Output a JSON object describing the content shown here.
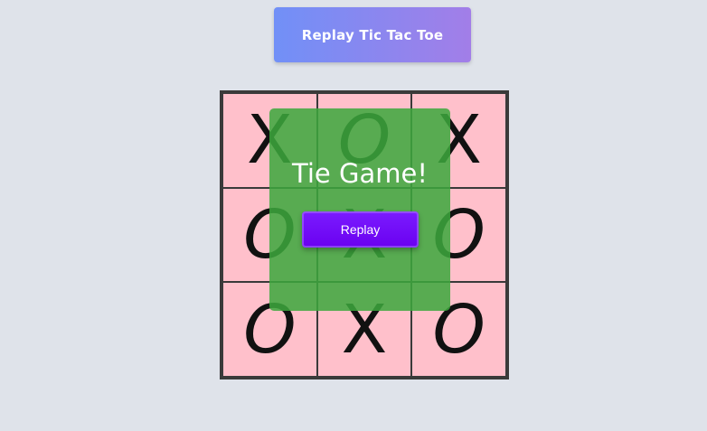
{
  "header": {
    "replay_label": "Replay Tic Tac Toe"
  },
  "board": {
    "cells": [
      "X",
      "O",
      "X",
      "O",
      "X",
      "O",
      "O",
      "X",
      "O"
    ]
  },
  "result": {
    "message": "Tie Game!",
    "replay_label": "Replay"
  },
  "colors": {
    "background": "#dfe3ea",
    "cell": "#ffc0cb",
    "overlay": "#3ca83c",
    "replay_button": "#6a00f0",
    "header_gradient_start": "#7190f7",
    "header_gradient_end": "#a27ee8"
  }
}
